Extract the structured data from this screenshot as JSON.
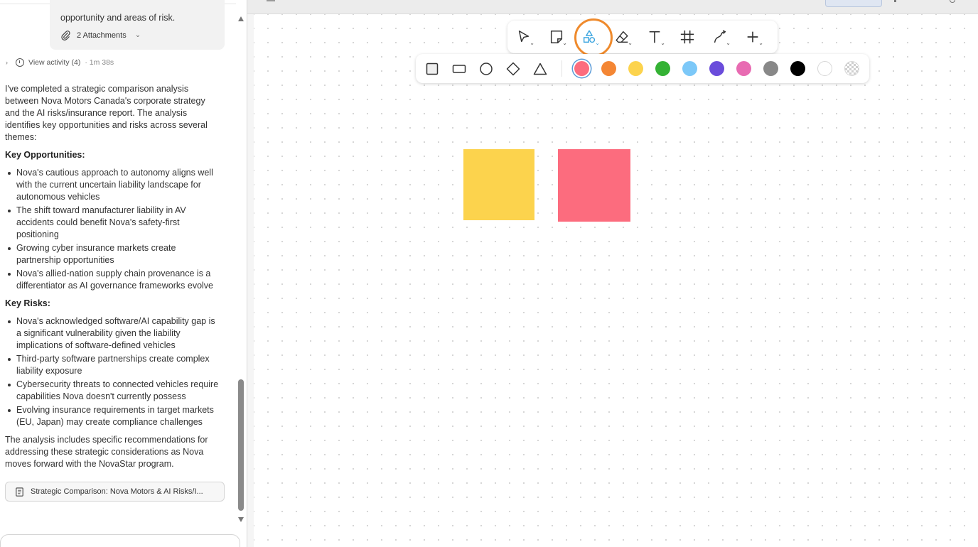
{
  "chat": {
    "user_message_tail": "opportunity and areas of risk.",
    "attachments_label": "2 Attachments",
    "activity_label": "View activity (4)",
    "activity_duration": "· 1m 38s",
    "intro": "I've completed a strategic comparison analysis between Nova Motors Canada's corporate strategy and the AI risks/insurance report. The analysis identifies key opportunities and risks across several themes:",
    "opportunities_heading": "Key Opportunities:",
    "opportunities": [
      "Nova's cautious approach to autonomy aligns well with the current uncertain liability landscape for autonomous vehicles",
      "The shift toward manufacturer liability in AV accidents could benefit Nova's safety-first positioning",
      "Growing cyber insurance markets create partnership opportunities",
      "Nova's allied-nation supply chain provenance is a differentiator as AI governance frameworks evolve"
    ],
    "risks_heading": "Key Risks:",
    "risks": [
      "Nova's acknowledged software/AI capability gap is a significant vulnerability given the liability implications of software-defined vehicles",
      "Third-party software partnerships create complex liability exposure",
      "Cybersecurity threats to connected vehicles require capabilities Nova doesn't currently possess",
      "Evolving insurance requirements in target markets (EU, Japan) may create compliance challenges"
    ],
    "closing": "The analysis includes specific recommendations for addressing these strategic considerations as Nova moves forward with the NovaStar program.",
    "artifact_label": "Strategic Comparison: Nova Motors & AI Risks/I..."
  },
  "toolbar": {
    "tools": [
      {
        "name": "select-tool",
        "icon": "cursor-icon"
      },
      {
        "name": "sticky-note-tool",
        "icon": "sticky-note-icon"
      },
      {
        "name": "shapes-tool",
        "icon": "shapes-icon",
        "active": true
      },
      {
        "name": "eraser-tool",
        "icon": "eraser-icon"
      },
      {
        "name": "text-tool",
        "icon": "text-icon"
      },
      {
        "name": "frame-tool",
        "icon": "frame-icon"
      },
      {
        "name": "connector-tool",
        "icon": "connector-icon"
      },
      {
        "name": "add-tool",
        "icon": "plus-icon"
      }
    ],
    "active_color": "#3ea6e0",
    "highlight_ring_color": "#ef8a2c"
  },
  "shape_options": [
    "square",
    "rectangle",
    "circle",
    "diamond",
    "triangle"
  ],
  "colors": [
    {
      "name": "red",
      "hex": "#fc6c7e",
      "selected": true
    },
    {
      "name": "orange",
      "hex": "#f48634"
    },
    {
      "name": "yellow",
      "hex": "#fcd34d"
    },
    {
      "name": "green",
      "hex": "#34b234"
    },
    {
      "name": "light-blue",
      "hex": "#7cc8f8"
    },
    {
      "name": "purple",
      "hex": "#6a4cdb"
    },
    {
      "name": "pink",
      "hex": "#e86bb2"
    },
    {
      "name": "gray",
      "hex": "#888888"
    },
    {
      "name": "black",
      "hex": "#000000"
    },
    {
      "name": "white",
      "hex": "#ffffff"
    },
    {
      "name": "transparent",
      "hex": "transparent"
    }
  ],
  "canvas": {
    "stickies": [
      {
        "name": "sticky-yellow",
        "color": "#fcd34d"
      },
      {
        "name": "sticky-pink",
        "color": "#fc6c7e"
      }
    ]
  }
}
